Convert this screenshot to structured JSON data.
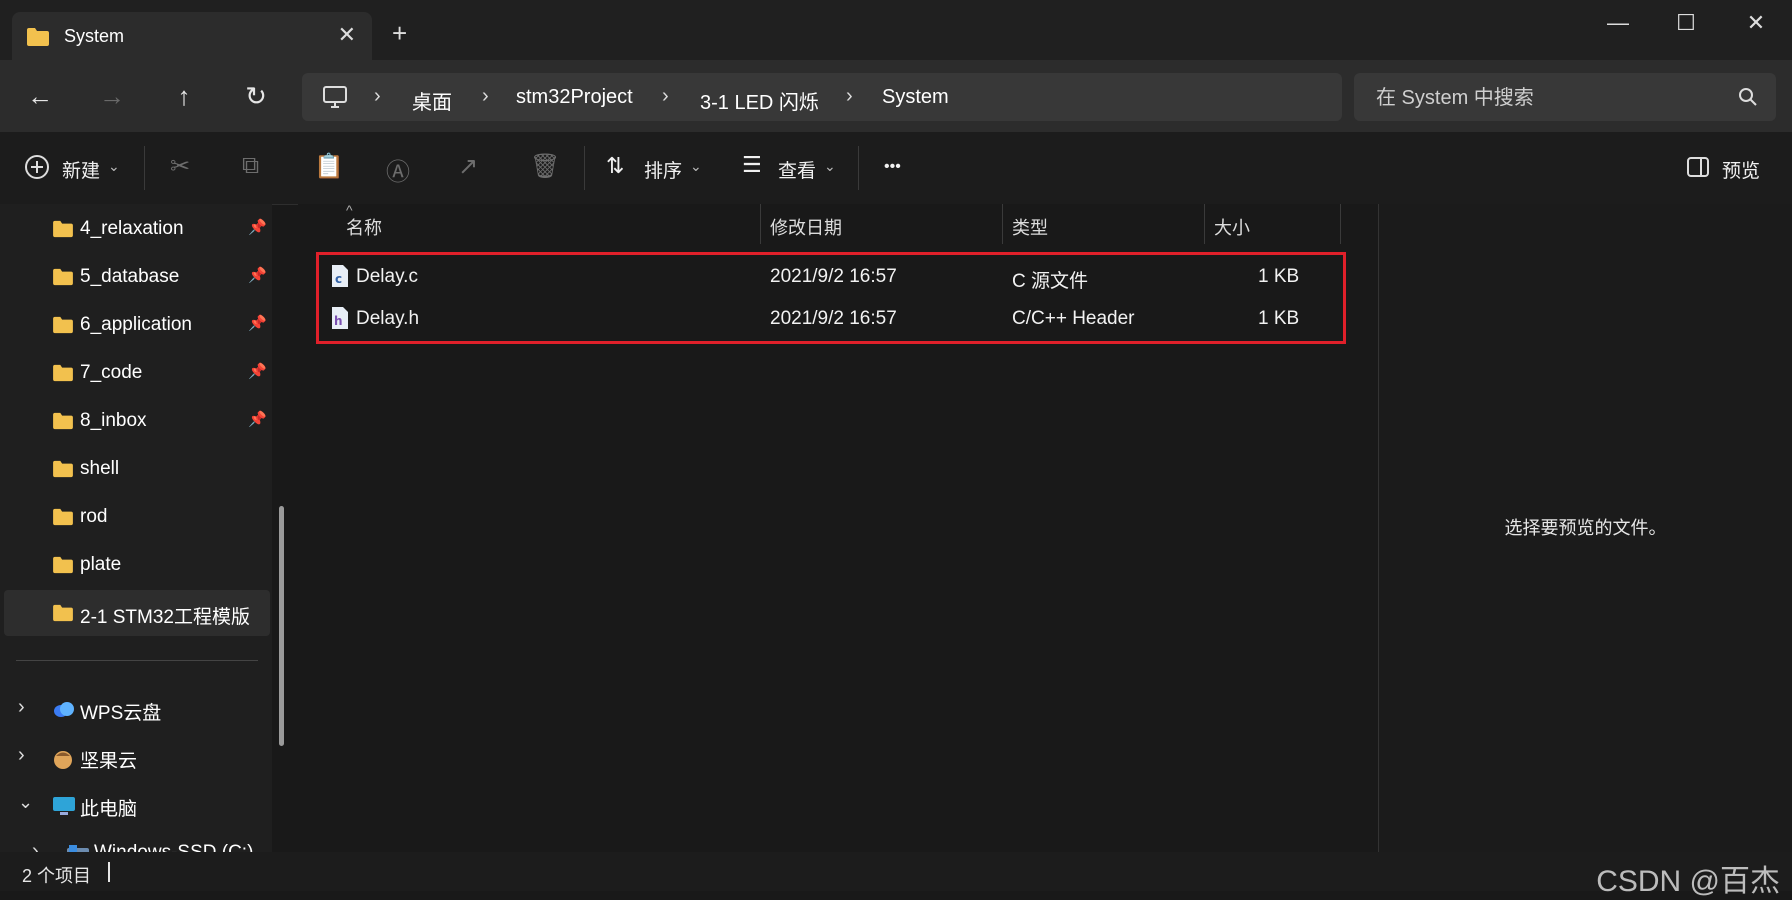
{
  "window": {
    "tab_title": "System",
    "new_tab_glyph": "+",
    "close_tab_glyph": "✕",
    "minimize_glyph": "—",
    "maximize_glyph": "☐",
    "close_glyph": "✕"
  },
  "nav": {
    "back_icon": "←",
    "forward_icon": "→",
    "up_icon": "↑",
    "refresh_icon": "↻",
    "breadcrumb": [
      "桌面",
      "stm32Project",
      "3-1 LED 闪烁",
      "System"
    ],
    "chevron": "›",
    "search_placeholder": "在 System 中搜索"
  },
  "toolbar": {
    "new_label": "新建",
    "sort_label": "排序",
    "view_label": "查看",
    "more_glyph": "•••",
    "preview_label": "预览"
  },
  "sidebar": {
    "items": [
      {
        "label": "4_relaxation",
        "pinned": true
      },
      {
        "label": "5_database",
        "pinned": true
      },
      {
        "label": "6_application",
        "pinned": true
      },
      {
        "label": "7_code",
        "pinned": true
      },
      {
        "label": "8_inbox",
        "pinned": true
      },
      {
        "label": "shell",
        "pinned": false
      },
      {
        "label": "rod",
        "pinned": false
      },
      {
        "label": "plate",
        "pinned": false
      },
      {
        "label": "2-1 STM32工程模版",
        "pinned": false,
        "selected": true
      }
    ],
    "locations": [
      {
        "label": "WPS云盘",
        "expanded": false,
        "icon": "cloud-icon"
      },
      {
        "label": "坚果云",
        "expanded": false,
        "icon": "nut-icon"
      },
      {
        "label": "此电脑",
        "expanded": true,
        "icon": "computer-icon"
      },
      {
        "label": "Windows-SSD (C:)",
        "expanded": false,
        "icon": "drive-icon"
      }
    ]
  },
  "columns": [
    "名称",
    "修改日期",
    "类型",
    "大小"
  ],
  "files": [
    {
      "name": "Delay.c",
      "date": "2021/9/2 16:57",
      "type": "C 源文件",
      "size": "1 KB",
      "icon": "c-file-icon"
    },
    {
      "name": "Delay.h",
      "date": "2021/9/2 16:57",
      "type": "C/C++ Header",
      "size": "1 KB",
      "icon": "h-file-icon"
    }
  ],
  "preview_message": "选择要预览的文件。",
  "status": {
    "item_count": "2 个项目"
  },
  "watermark": "CSDN @百杰",
  "colors": {
    "highlight_border": "#e0202a",
    "folder": "#f2c14e",
    "accent": "#4aa3ff"
  }
}
